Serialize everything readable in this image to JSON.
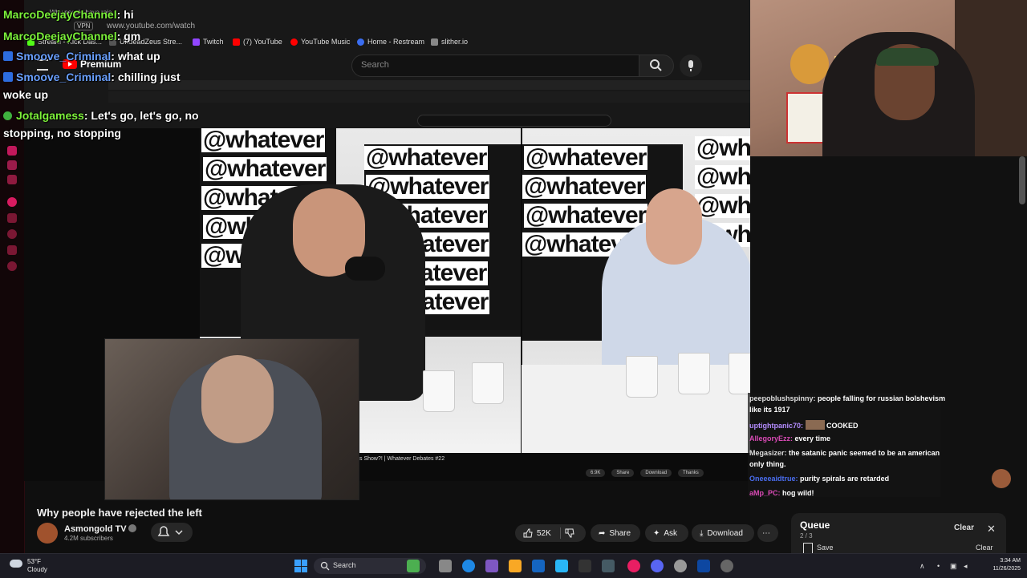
{
  "browser": {
    "tab_title": "Why people have reje...",
    "url": "www.youtube.com/watch",
    "vpn_label": "VPN",
    "bookmarks": [
      "Stream - Kick Das...",
      "UndeadZeus Stre...",
      "Twitch",
      "(7) YouTube",
      "YouTube Music",
      "Home - Restream",
      "slither.io"
    ],
    "search_placeholder": "Search",
    "logo_label": "Premium"
  },
  "inner_video": {
    "watermark": "@whatever",
    "caption": "s Show?! | Whatever Debates #22",
    "actions": [
      "6.9K",
      "Share",
      "Download",
      "Thanks"
    ]
  },
  "chat_overlay": [
    {
      "user": "MarcoDeejayChannel",
      "msg": ": hi"
    },
    {
      "user": "MarcoDeejayChannel",
      "msg": ": gm"
    },
    {
      "user": "Smoove_Criminal",
      "msg": ": what up"
    },
    {
      "user": "Smoove_Criminal",
      "msg": ": chilling just"
    },
    {
      "user": "",
      "msg": "woke up"
    },
    {
      "user": "Jotalgamess",
      "msg": ": Let's go, let's go, no"
    },
    {
      "user": "",
      "msg": "stopping, no stopping"
    }
  ],
  "mini_chat": [
    {
      "user": "peepoblushspinny:",
      "msg": "people falling for russian bolshevism"
    },
    {
      "user": "",
      "msg": "like its 1917"
    },
    {
      "user": "uptightpanic70:",
      "msg": "COOKED"
    },
    {
      "user": "AllegoryEzz:",
      "msg": "every time"
    },
    {
      "user": "Megasizer:",
      "msg": "the satanic panic seemed to be an american"
    },
    {
      "user": "",
      "msg": "only thing."
    },
    {
      "user": "Oneeeaidtrue:",
      "msg": "purity spirals are retarded"
    },
    {
      "user": "aMp_PC:",
      "msg": "hog wild!"
    }
  ],
  "video": {
    "title": "Why people have rejected the left",
    "channel": "Asmongold TV",
    "subscribers": "4.2M subscribers",
    "likes": "52K",
    "share_label": "Share",
    "ask_label": "Ask",
    "download_label": "Download",
    "more_label": "⋯"
  },
  "queue": {
    "title": "Queue",
    "count": "2 / 3",
    "clear_label": "Clear",
    "close_label": "✕",
    "save_label": "Save",
    "clear2_label": "Clear"
  },
  "taskbar": {
    "temp": "53°F",
    "weather": "Cloudy",
    "search_label": "Search",
    "time": "3:34 AM",
    "date": "11/26/2025"
  },
  "colors": {
    "chat_name_green": "#7cf03a",
    "chat_name_blue": "#6aa0ff",
    "youtube_red": "#ff0000"
  }
}
